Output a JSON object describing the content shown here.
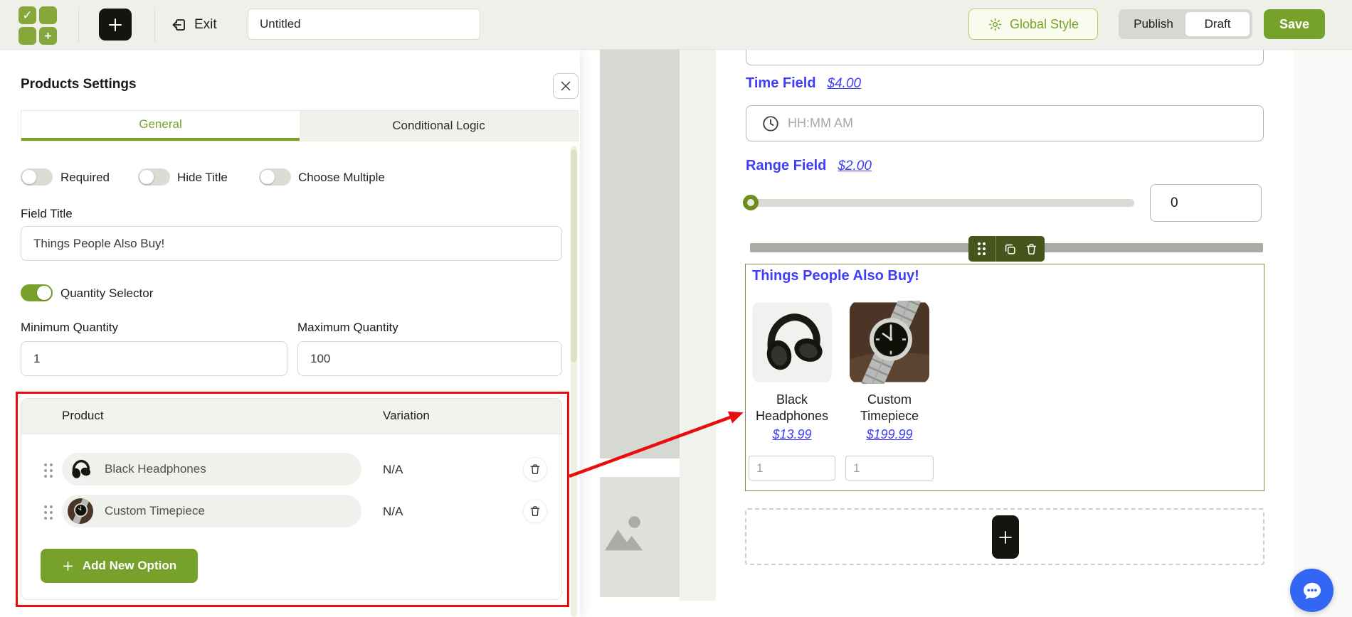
{
  "topbar": {
    "logo_icon": "checkmark-plus-grid-logo",
    "logo_check_glyph": "✓",
    "logo_plus_glyph": "+",
    "exit": {
      "icon": "exit-arrow-icon",
      "label": "Exit"
    },
    "form_title": {
      "value": "Untitled"
    },
    "global_style": {
      "icon": "gear-icon",
      "label": "Global Style"
    },
    "status_switch": {
      "publish_label": "Publish",
      "draft_label": "Draft",
      "selected": "Draft"
    },
    "save_label": "Save"
  },
  "settings_panel": {
    "title": "Products Settings",
    "close_icon": "close-icon",
    "tabs": {
      "general": "General",
      "conditional_logic": "Conditional Logic",
      "active": "General"
    },
    "toggles": {
      "required": {
        "label": "Required",
        "on": false
      },
      "hide_title": {
        "label": "Hide Title",
        "on": false
      },
      "choose_multiple": {
        "label": "Choose Multiple",
        "on": false
      }
    },
    "field_title": {
      "label": "Field Title",
      "value": "Things People Also Buy!"
    },
    "quantity_selector": {
      "label": "Quantity Selector",
      "on": true
    },
    "minimum_quantity": {
      "label": "Minimum Quantity",
      "value": "1"
    },
    "maximum_quantity": {
      "label": "Maximum Quantity",
      "value": "100"
    },
    "products_table": {
      "product_column": "Product",
      "variation_column": "Variation",
      "rows": [
        {
          "product": "Black Headphones",
          "variation": "N/A",
          "thumb_icon": "headphones-photo"
        },
        {
          "product": "Custom Timepiece",
          "variation": "N/A",
          "thumb_icon": "watch-photo"
        }
      ],
      "add_button": {
        "label": "Add New Option",
        "icon": "plus-icon"
      }
    }
  },
  "canvas": {
    "time_field": {
      "label": "Time Field",
      "price": "$4.00",
      "placeholder": "HH:MM AM",
      "icon": "clock-icon"
    },
    "range_field": {
      "label": "Range Field",
      "price": "$2.00",
      "value": "0"
    },
    "products_field": {
      "title": "Things People Also Buy!",
      "items": [
        {
          "name": "Black Headphones",
          "price": "$13.99",
          "quantity": "1",
          "image_icon": "headphones-photo"
        },
        {
          "name": "Custom Timepiece",
          "price": "$199.99",
          "quantity": "1",
          "image_icon": "watch-photo"
        }
      ]
    },
    "toolbar_icons": [
      "drag-handle-icon",
      "duplicate-icon",
      "trash-icon"
    ],
    "add_field_icon": "plus-icon",
    "placeholder_icon": "image-placeholder-icon",
    "chat_icon": "chat-bubble-icon"
  },
  "colors": {
    "accent_green": "#76a22b",
    "toolbar_olive": "#46551c",
    "field_label_blue": "#3d3dfa",
    "highlight_red": "#e90d0d",
    "chat_blue": "#3366f2",
    "topbar_bg": "#eff0ea"
  }
}
